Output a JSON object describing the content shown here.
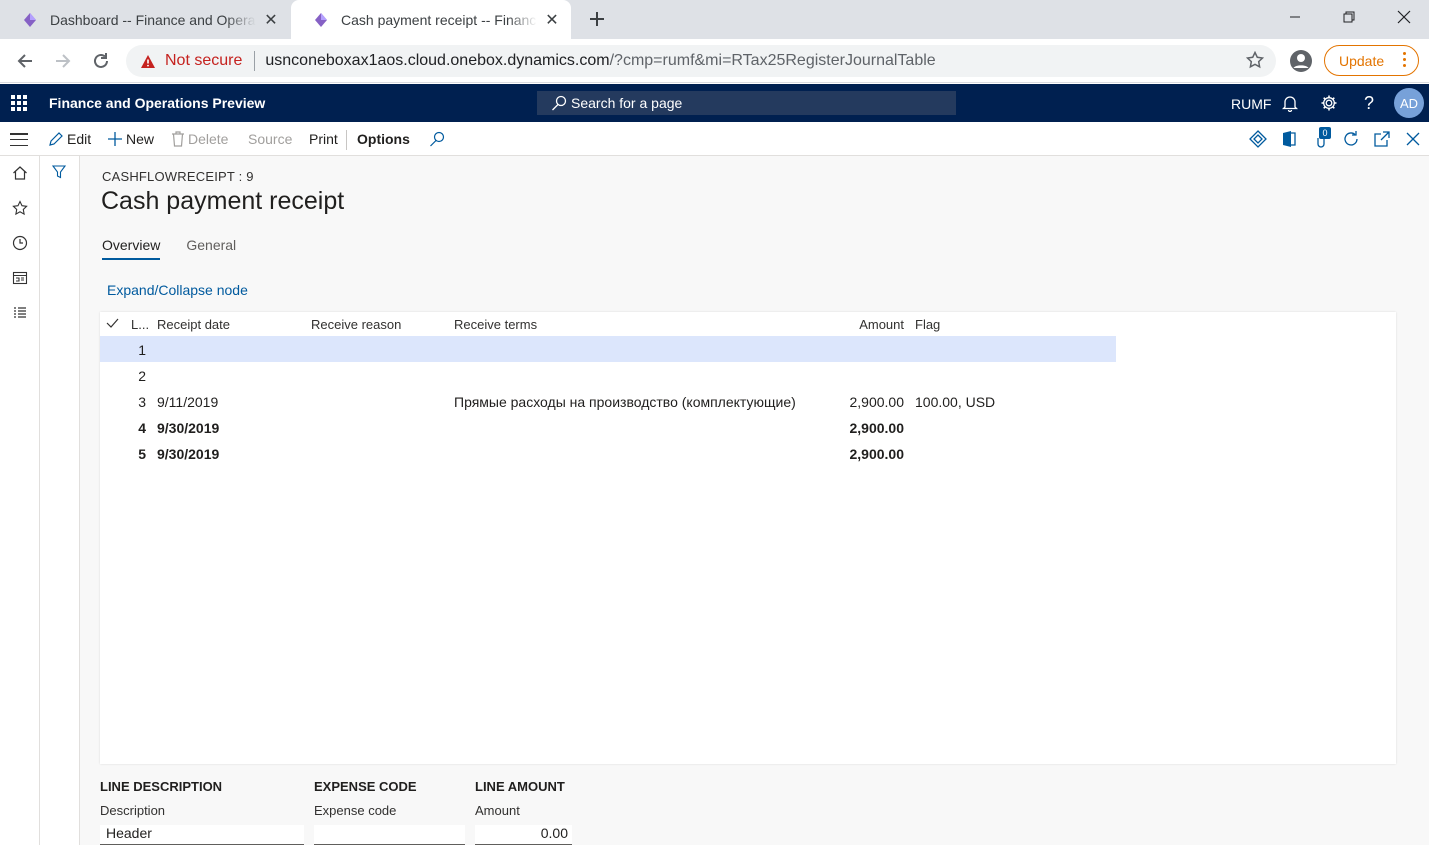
{
  "browser": {
    "tabs": [
      {
        "title": "Dashboard -- Finance and Operations",
        "active": false
      },
      {
        "title": "Cash payment receipt -- Finance and Operations",
        "active": true
      }
    ],
    "address": {
      "security_label": "Not secure",
      "host": "usnconeboxax1aos.cloud.onebox.dynamics.com",
      "path": "/?cmp=rumf&mi=RTax25RegisterJournalTable"
    },
    "update_label": "Update"
  },
  "appbar": {
    "app_name": "Finance and Operations Preview",
    "search_placeholder": "Search for a page",
    "company": "RUMF",
    "avatar_initials": "AD"
  },
  "actions": {
    "edit": "Edit",
    "new": "New",
    "delete": "Delete",
    "source": "Source",
    "print": "Print",
    "options": "Options",
    "attach_count": "0"
  },
  "page": {
    "caption": "CASHFLOWRECEIPT : 9",
    "title": "Cash payment receipt",
    "tabs": [
      "Overview",
      "General"
    ],
    "expand_link": "Expand/Collapse node"
  },
  "grid": {
    "columns": {
      "line": "L...",
      "receipt_date": "Receipt date",
      "receive_reason": "Receive reason",
      "receive_terms": "Receive terms",
      "amount": "Amount",
      "flag": "Flag"
    },
    "rows": [
      {
        "line": "1",
        "receipt_date": "",
        "receive_reason": "",
        "receive_terms": "",
        "amount": "",
        "flag": ""
      },
      {
        "line": "2",
        "receipt_date": "",
        "receive_reason": "",
        "receive_terms": "",
        "amount": "",
        "flag": ""
      },
      {
        "line": "3",
        "receipt_date": "9/11/2019",
        "receive_reason": "",
        "receive_terms": "Прямые расходы на производство (комплектующие)",
        "amount": "2,900.00",
        "flag": "100.00, USD"
      },
      {
        "line": "4",
        "receipt_date": "9/30/2019",
        "receive_reason": "",
        "receive_terms": "",
        "amount": "2,900.00",
        "flag": ""
      },
      {
        "line": "5",
        "receipt_date": "9/30/2019",
        "receive_reason": "",
        "receive_terms": "",
        "amount": "2,900.00",
        "flag": ""
      }
    ]
  },
  "details": {
    "line_description": {
      "header": "LINE DESCRIPTION",
      "label": "Description",
      "value": "Header"
    },
    "expense_code": {
      "header": "EXPENSE CODE",
      "label": "Expense code",
      "value": ""
    },
    "line_amount": {
      "header": "LINE AMOUNT",
      "label": "Amount",
      "value": "0.00"
    }
  },
  "colors": {
    "navbar": "#002050",
    "accent": "#005a9e",
    "selected_row": "#dce6fc",
    "update": "#e37400",
    "not_secure": "#c5221f"
  }
}
